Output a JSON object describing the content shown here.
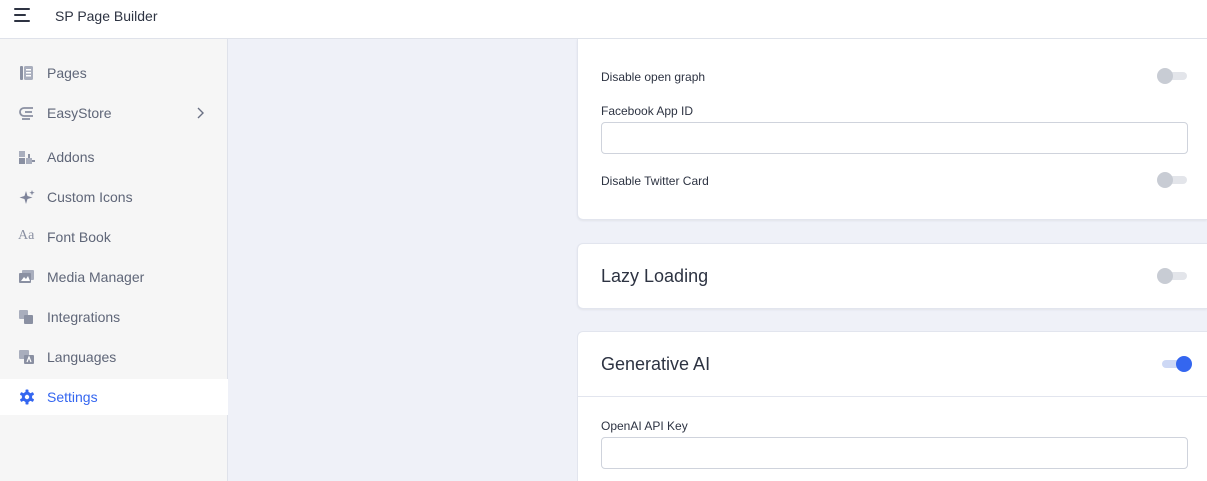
{
  "header": {
    "app_title": "SP Page Builder",
    "menu_icon": "hamburger-icon"
  },
  "sidebar": {
    "items": [
      {
        "label": "Pages",
        "icon": "pages-icon"
      },
      {
        "label": "EasyStore",
        "icon": "easystore-icon",
        "has_submenu": true
      },
      {
        "label": "Addons",
        "icon": "addons-icon"
      },
      {
        "label": "Custom Icons",
        "icon": "sparkle-icon"
      },
      {
        "label": "Font Book",
        "icon": "font-icon",
        "icon_text": "Aa"
      },
      {
        "label": "Media Manager",
        "icon": "media-icon"
      },
      {
        "label": "Integrations",
        "icon": "integrations-icon"
      },
      {
        "label": "Languages",
        "icon": "languages-icon"
      },
      {
        "label": "Settings",
        "icon": "gear-icon",
        "active": true
      }
    ]
  },
  "social": {
    "disable_open_graph_label": "Disable open graph",
    "disable_open_graph_on": false,
    "facebook_app_id_label": "Facebook App ID",
    "facebook_app_id_value": "",
    "disable_twitter_card_label": "Disable Twitter Card",
    "disable_twitter_card_on": false
  },
  "lazy_loading": {
    "title": "Lazy Loading",
    "enabled": false
  },
  "generative_ai": {
    "title": "Generative AI",
    "enabled": true,
    "openai_key_label": "OpenAI API Key",
    "openai_key_value": ""
  },
  "colors": {
    "accent": "#3466f0",
    "sidebar_bg": "#f6f6f6",
    "content_bg": "#eff1f8",
    "toggle_off": "#c8ccd4"
  }
}
